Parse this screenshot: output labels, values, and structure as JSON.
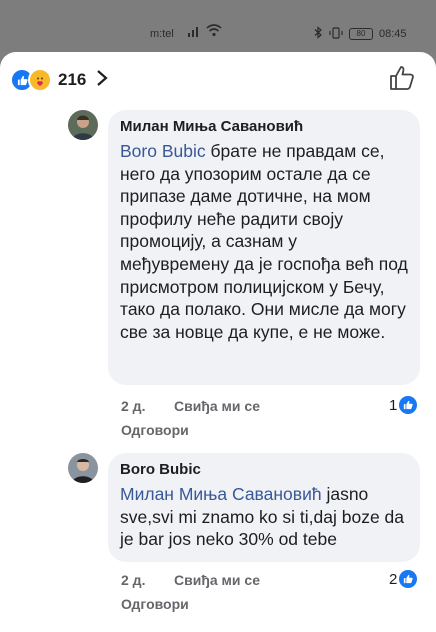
{
  "status_bar": {
    "carrier": "m:tel",
    "battery": "80",
    "time": "08:45"
  },
  "header": {
    "reaction_count": "216",
    "icons": [
      "like-reaction-icon",
      "care-reaction-icon",
      "chevron-right-icon",
      "like-outline-icon"
    ]
  },
  "comments": [
    {
      "author": "Милан Миња Савановић",
      "mention": "Boro Bubic",
      "text": " брате не правдам се, нeго да упозорим остале да се припазе даме дотичне, на мом профилу нeће радити своју промоцију, а сазнам у међувремену да је госпођа већ под присмотром полицијском у Бечу, тако да полако. Они мисле да могу све за новце да купе, е не може.",
      "time": "2 д.",
      "like_label": "Свиђа ми се",
      "reply_label": "Одговори",
      "likes": "1"
    },
    {
      "author": "Boro Bubic",
      "mention": "Милан Миња Савановић",
      "text": " jasno sve,svi mi znamo ko si ti,daj boze da je bar jos neko 30% od tebe",
      "time": "2 д.",
      "like_label": "Свиђа ми се",
      "reply_label": "Одговори",
      "likes": "2"
    }
  ],
  "colors": {
    "mention": "#385898",
    "bubble": "#f0f2f5",
    "like_blue": "#1877f2",
    "meta_gray": "#65676b"
  }
}
